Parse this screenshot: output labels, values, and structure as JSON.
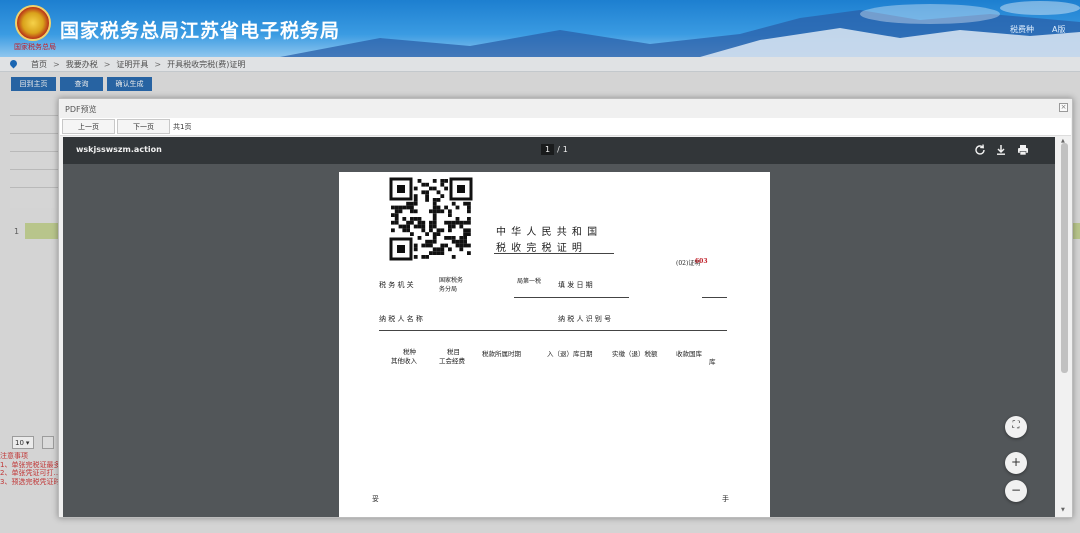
{
  "header": {
    "emblem_sub": "国家税务总局",
    "site_title": "国家税务总局江苏省电子税务局",
    "top_links": [
      "税费种",
      "A版"
    ]
  },
  "breadcrumb": {
    "items": [
      "首页",
      "我要办税",
      "证明开具",
      "开具税收完税(费)证明"
    ],
    "separator": ">"
  },
  "page_buttons": [
    "回到主页",
    "查询",
    "确认生成"
  ],
  "table": {
    "row_index": "1"
  },
  "pagination": {
    "page_size": "10",
    "page_size_arrow": "▾"
  },
  "notes": {
    "title": "注意事项",
    "lines": [
      "1、单张完税证最多…",
      "2、单张凭证可打…",
      "3、预选完税凭证时…"
    ]
  },
  "modal": {
    "title": "PDF预览",
    "close": "×",
    "prev_label": "上一页",
    "next_label": "下一页",
    "total_pages": "共1页"
  },
  "viewer": {
    "filename": "wskjsswszm.action",
    "current_page": "1",
    "page_separator": "/",
    "total_page": "1",
    "icons": [
      "rotate-icon",
      "download-icon",
      "print-icon"
    ],
    "fit_icon": "⛶",
    "zoom_in": "+",
    "zoom_out": "−"
  },
  "document": {
    "title_line1": "中 华 人 民 共 和 国",
    "title_line2": "税 收 完 税 证 明",
    "cert_prefix": "(02)证明",
    "cert_number": "603",
    "tax_authority_label": "税 务 机 关",
    "tax_authority_value_1": "国家税务",
    "tax_authority_value_2": "务分局",
    "tax_authority_extra": "局第一税",
    "issue_date_label": "填 发 日 期",
    "taxpayer_name_label": "纳 税 人 名 称",
    "taxpayer_id_label": "纳 税 人 识 别 号",
    "col_tax_type_1": "税种",
    "col_tax_type_2": "其他收入",
    "col_item_1": "税目",
    "col_item_2": "工会经费",
    "col_period": "税款所属时期",
    "col_date": "入（退）库日期",
    "col_amount": "实缴（退）税额",
    "col_treasury": "收款国库",
    "col_treasury_2": "库",
    "footer_left": "妥",
    "footer_right": "手"
  },
  "colors": {
    "header_blue": "#1d7fd0",
    "button_blue": "#2b6cb0",
    "viewer_bg": "#525659",
    "viewer_bar": "#323639",
    "notes_red": "#d23b3b",
    "cert_red": "#c0202a"
  }
}
